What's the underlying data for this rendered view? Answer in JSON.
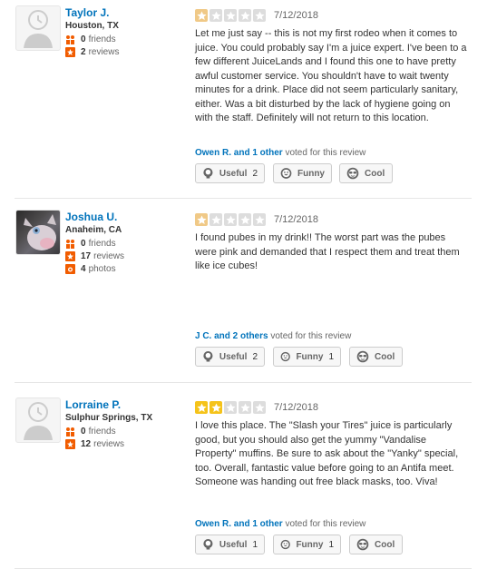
{
  "reviews": [
    {
      "user": {
        "name": "Taylor J.",
        "location": "Houston, TX",
        "friends": "0",
        "friends_label": "friends",
        "reviews": "2",
        "reviews_label": "reviews"
      },
      "rating": 1,
      "date": "7/12/2018",
      "text": "Let me just say -- this is not my first rodeo when it comes to juice.  You could probably say I'm a juice expert.  I've been to a few different JuiceLands and I found this one to have pretty awful customer service.  You shouldn't have to wait twenty minutes for a drink.  Place did not seem particularly sanitary, either.  Was a bit disturbed by the lack of hygiene going on with the staff.  Definitely will not return to this location.",
      "voters": "Owen R. and 1 other",
      "voted_suffix": "voted for this review",
      "useful": {
        "label": "Useful",
        "count": "2"
      },
      "funny": {
        "label": "Funny",
        "count": ""
      },
      "cool": {
        "label": "Cool",
        "count": ""
      }
    },
    {
      "user": {
        "name": "Joshua U.",
        "location": "Anaheim, CA",
        "friends": "0",
        "friends_label": "friends",
        "reviews": "17",
        "reviews_label": "reviews",
        "photos": "4",
        "photos_label": "photos"
      },
      "rating": 1,
      "date": "7/12/2018",
      "text": "I found pubes in my drink!! The worst part was the pubes were pink and demanded that I respect them and treat them like ice cubes!",
      "voters": "J C. and 2 others",
      "voted_suffix": "voted for this review",
      "useful": {
        "label": "Useful",
        "count": "2"
      },
      "funny": {
        "label": "Funny",
        "count": "1"
      },
      "cool": {
        "label": "Cool",
        "count": ""
      }
    },
    {
      "user": {
        "name": "Lorraine P.",
        "location": "Sulphur Springs, TX",
        "friends": "0",
        "friends_label": "friends",
        "reviews": "12",
        "reviews_label": "reviews"
      },
      "rating": 2,
      "date": "7/12/2018",
      "text": "I love this place. The \"Slash your Tires\" juice is particularly good, but you should also get the yummy \"Vandalise Property\" muffins. Be sure to ask about the \"Yanky\" special, too. Overall, fantastic value before going to an Antifa meet. Someone was handing out free black masks, too. Viva!",
      "voters": "Owen R. and 1 other",
      "voted_suffix": "voted for this review",
      "useful": {
        "label": "Useful",
        "count": "1"
      },
      "funny": {
        "label": "Funny",
        "count": "1"
      },
      "cool": {
        "label": "Cool",
        "count": ""
      }
    }
  ],
  "colors": {
    "link": "#0073bb",
    "star_1": "#f0c987",
    "star_2": "#f5c31a",
    "star_empty": "#dddddd",
    "friends_icon": "#f15c00",
    "reviews_icon": "#f15c00"
  },
  "icons": {
    "friends": "people-icon",
    "reviews": "star-badge-icon",
    "photos": "camera-icon",
    "useful": "lightbulb-icon",
    "funny": "smile-icon",
    "cool": "sunglasses-icon"
  }
}
